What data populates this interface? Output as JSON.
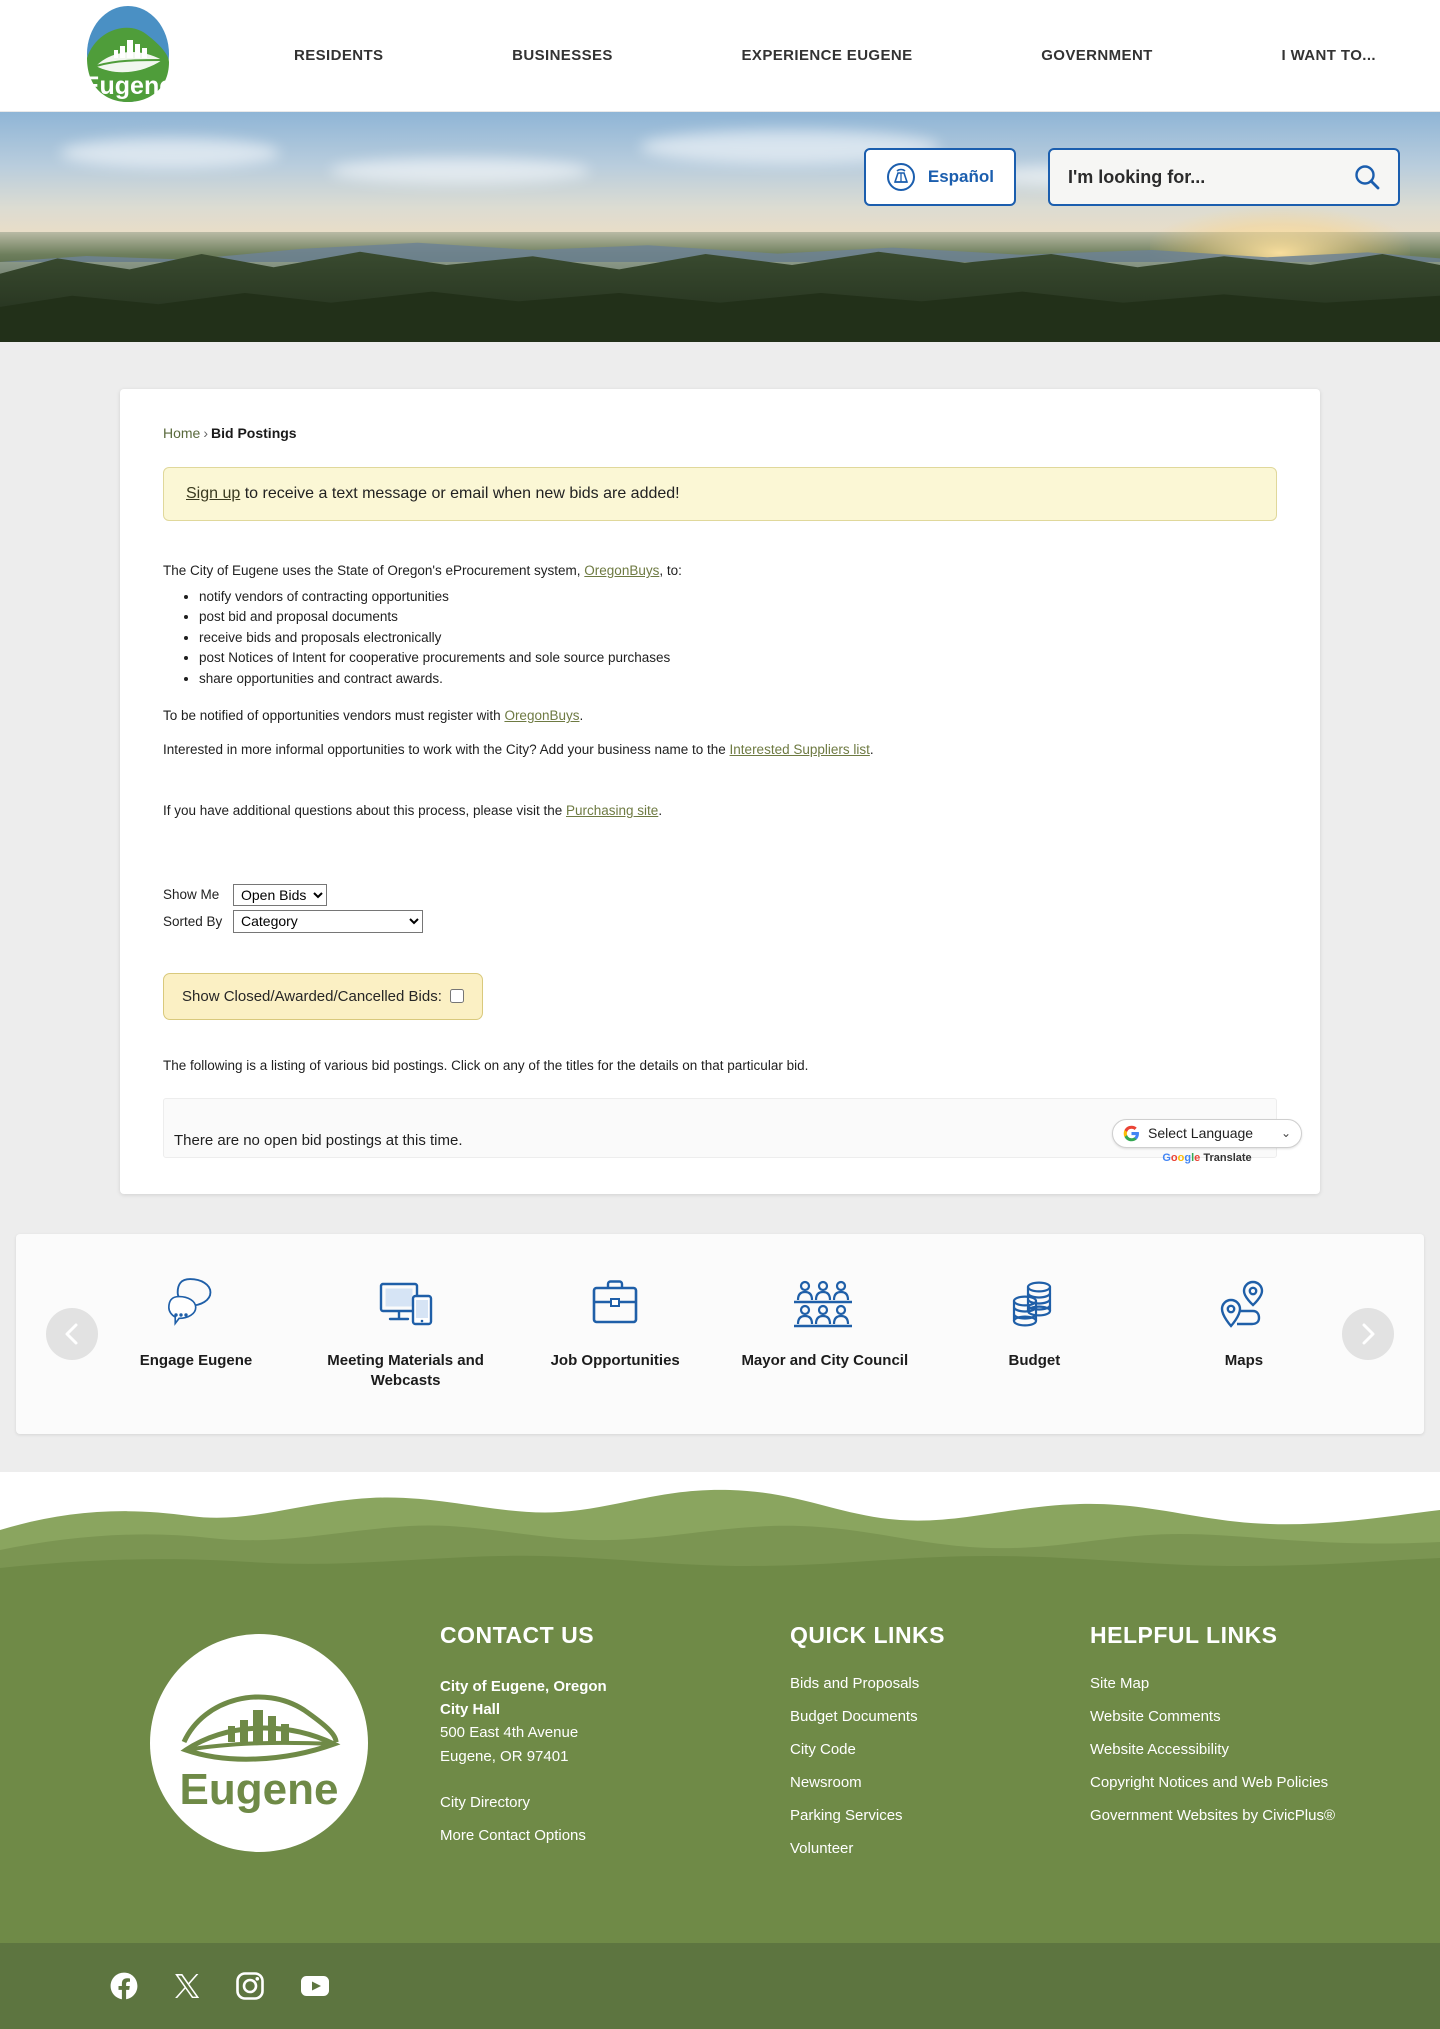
{
  "header": {
    "logo_alt": "Eugene",
    "nav": [
      {
        "label": "RESIDENTS"
      },
      {
        "label": "BUSINESSES"
      },
      {
        "label": "EXPERIENCE EUGENE"
      },
      {
        "label": "GOVERNMENT"
      },
      {
        "label": "I WANT TO..."
      }
    ]
  },
  "hero": {
    "espanol_label": "Español",
    "search_placeholder": "I'm looking for...",
    "search_value": ""
  },
  "breadcrumb": {
    "home": "Home",
    "separator": "›",
    "current": "Bid Postings"
  },
  "notice": {
    "link": "Sign up",
    "text": " to receive a text message or email when new bids are added!"
  },
  "article": {
    "intro_before": "The City of Eugene uses the State of Oregon's eProcurement system, ",
    "intro_link": "OregonBuys",
    "intro_after": ", to:",
    "bullets": [
      "notify vendors of contracting opportunities",
      "post bid and proposal documents",
      "receive bids and proposals electronically",
      "post Notices of Intent for cooperative procurements and sole source purchases",
      "share opportunities and contract awards."
    ],
    "register_before": "To be notified of opportunities vendors must register with ",
    "register_link": "OregonBuys",
    "register_after": ".",
    "informal_before": "Interested in more informal opportunities to work with the City? Add your business name to the ",
    "informal_link": "Interested Suppliers list",
    "informal_after": ".",
    "questions_before": "If you have additional questions about this process, please visit the ",
    "questions_link": "Purchasing site",
    "questions_after": "."
  },
  "filters": {
    "show_me_label": "Show Me",
    "show_me_value": "Open Bids",
    "show_me_options": [
      "Open Bids"
    ],
    "sorted_by_label": "Sorted By",
    "sorted_by_value": "Category",
    "sorted_by_options": [
      "Category"
    ],
    "closed_bids_label": "Show Closed/Awarded/Cancelled Bids:",
    "closed_bids_checked": false
  },
  "listing": {
    "note": "The following is a listing of various bid postings. Click on any of the titles for the details on that particular bid.",
    "empty_message": "There are no open bid postings at this time."
  },
  "translate": {
    "selected": "Select Language",
    "caret": "⌄",
    "brand_google": "Google",
    "brand_translate": "Translate"
  },
  "carousel": {
    "prev_label": "Previous",
    "next_label": "Next",
    "items": [
      {
        "label": "Engage Eugene",
        "icon": "speech-bubbles-icon"
      },
      {
        "label": "Meeting Materials and Webcasts",
        "icon": "monitor-tablet-icon"
      },
      {
        "label": "Job Opportunities",
        "icon": "briefcase-icon"
      },
      {
        "label": "Mayor and City Council",
        "icon": "people-group-icon"
      },
      {
        "label": "Budget",
        "icon": "coin-stacks-icon"
      },
      {
        "label": "Maps",
        "icon": "map-pins-icon"
      }
    ]
  },
  "footer": {
    "logo_alt": "Eugene",
    "contact": {
      "title": "CONTACT US",
      "org": "City of Eugene, Oregon",
      "building": "City Hall",
      "street": "500 East 4th Avenue",
      "citystate": "Eugene, OR 97401",
      "links": [
        {
          "label": "City Directory"
        },
        {
          "label": "More Contact Options"
        }
      ]
    },
    "quick": {
      "title": "QUICK LINKS",
      "links": [
        {
          "label": "Bids and Proposals"
        },
        {
          "label": "Budget Documents"
        },
        {
          "label": "City Code"
        },
        {
          "label": "Newsroom"
        },
        {
          "label": "Parking Services"
        },
        {
          "label": "Volunteer"
        }
      ]
    },
    "helpful": {
      "title": "HELPFUL LINKS",
      "links": [
        {
          "label": "Site Map"
        },
        {
          "label": "Website Comments"
        },
        {
          "label": "Website Accessibility"
        },
        {
          "label": "Copyright Notices and Web Policies"
        },
        {
          "label": "Government Websites by CivicPlus®"
        }
      ]
    },
    "social": [
      {
        "name": "facebook-icon"
      },
      {
        "name": "x-twitter-icon"
      },
      {
        "name": "instagram-icon"
      },
      {
        "name": "youtube-icon"
      }
    ]
  },
  "colors": {
    "brand_green": "#6f8a47",
    "brand_blue": "#1b5eae",
    "accent_link": "#6e7a42",
    "notice_yellow": "#fbf7d5",
    "social_bar": "#5d7540"
  }
}
